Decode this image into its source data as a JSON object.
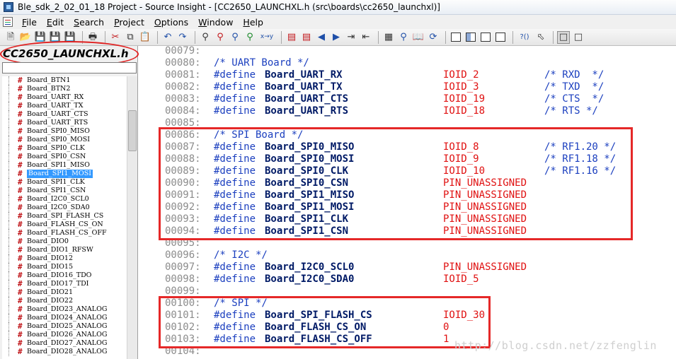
{
  "window": {
    "title": "Ble_sdk_2_02_01_18 Project - Source Insight - [CC2650_LAUNCHXL.h (src\\boards\\cc2650_launchxl)]"
  },
  "menu": [
    {
      "pre": "",
      "u": "F",
      "post": "ile"
    },
    {
      "pre": "",
      "u": "E",
      "post": "dit"
    },
    {
      "pre": "",
      "u": "S",
      "post": "earch"
    },
    {
      "pre": "",
      "u": "P",
      "post": "roject"
    },
    {
      "pre": "",
      "u": "O",
      "post": "ptions"
    },
    {
      "pre": "",
      "u": "W",
      "post": "indow"
    },
    {
      "pre": "",
      "u": "H",
      "post": "elp"
    }
  ],
  "toolbar": {
    "icons": [
      "new-file-icon",
      "open-folder-icon",
      "save-icon",
      "save-all-icon",
      "close-file-icon",
      "separator",
      "print-icon",
      "separator",
      "cut-icon",
      "copy-icon",
      "paste-icon",
      "separator",
      "undo-icon",
      "redo-icon",
      "separator",
      "search-icon",
      "search-files-icon",
      "search-project-icon",
      "lookup-references-icon",
      "replace-icon",
      "separator",
      "jump-bookmark-icon",
      "jump-list-icon",
      "back-icon",
      "forward-icon",
      "next-link-icon",
      "previous-link-icon",
      "separator",
      "symbol-window-icon",
      "relation-window-icon",
      "context-window-icon",
      "sync-icon",
      "separator",
      "project-window-icon",
      "layout-icon",
      "split-window-icon",
      "tile-icon",
      "separator",
      "help-icon",
      "cursor-icon",
      "separator",
      "toggle-view-icon",
      "toggle-panel-icon"
    ],
    "replace_label": "x→y",
    "help_label": "?()"
  },
  "sidebar": {
    "file_title": "CC2650_LAUNCHXL.h",
    "search_value": "",
    "symbols": [
      "Board_BTN1",
      "Board_BTN2",
      "Board_UART_RX",
      "Board_UART_TX",
      "Board_UART_CTS",
      "Board_UART_RTS",
      "Board_SPI0_MISO",
      "Board_SPI0_MOSI",
      "Board_SPI0_CLK",
      "Board_SPI0_CSN",
      "Board_SPI1_MISO",
      "Board_SPI1_MOSI",
      "Board_SPI1_CLK",
      "Board_SPI1_CSN",
      "Board_I2C0_SCL0",
      "Board_I2C0_SDA0",
      "Board_SPI_FLASH_CS",
      "Board_FLASH_CS_ON",
      "Board_FLASH_CS_OFF",
      "Board_DIO0",
      "Board_DIO1_RFSW",
      "Board_DIO12",
      "Board_DIO15",
      "Board_DIO16_TDO",
      "Board_DIO17_TDI",
      "Board_DIO21",
      "Board_DIO22",
      "Board_DIO23_ANALOG",
      "Board_DIO24_ANALOG",
      "Board_DIO25_ANALOG",
      "Board_DIO26_ANALOG",
      "Board_DIO27_ANALOG",
      "Board_DIO28_ANALOG"
    ],
    "selected_index": 11
  },
  "editor": {
    "lines": [
      {
        "n": "00079:",
        "kind": "blank"
      },
      {
        "n": "00080:",
        "kind": "comment",
        "text": "/* UART Board */"
      },
      {
        "n": "00081:",
        "kind": "define",
        "kw": "#define",
        "name": "Board_UART_RX",
        "value": "IOID_2",
        "comment": "/* RXD  */"
      },
      {
        "n": "00082:",
        "kind": "define",
        "kw": "#define",
        "name": "Board_UART_TX",
        "value": "IOID_3",
        "comment": "/* TXD  */"
      },
      {
        "n": "00083:",
        "kind": "define",
        "kw": "#define",
        "name": "Board_UART_CTS",
        "value": "IOID_19",
        "comment": "/* CTS  */"
      },
      {
        "n": "00084:",
        "kind": "define",
        "kw": "#define",
        "name": "Board_UART_RTS",
        "value": "IOID_18",
        "comment": "/* RTS */"
      },
      {
        "n": "00085:",
        "kind": "blank"
      },
      {
        "n": "00086:",
        "kind": "comment",
        "text": "/* SPI Board */"
      },
      {
        "n": "00087:",
        "kind": "define",
        "kw": "#define",
        "name": "Board_SPI0_MISO",
        "value": "IOID_8",
        "comment": "/* RF1.20 */"
      },
      {
        "n": "00088:",
        "kind": "define",
        "kw": "#define",
        "name": "Board_SPI0_MOSI",
        "value": "IOID_9",
        "comment": "/* RF1.18 */"
      },
      {
        "n": "00089:",
        "kind": "define",
        "kw": "#define",
        "name": "Board_SPI0_CLK",
        "value": "IOID_10",
        "comment": "/* RF1.16 */"
      },
      {
        "n": "00090:",
        "kind": "define",
        "kw": "#define",
        "name": "Board_SPI0_CSN",
        "value": "PIN_UNASSIGNED",
        "comment": ""
      },
      {
        "n": "00091:",
        "kind": "define",
        "kw": "#define",
        "name": "Board_SPI1_MISO",
        "value": "PIN_UNASSIGNED",
        "comment": ""
      },
      {
        "n": "00092:",
        "kind": "define",
        "kw": "#define",
        "name": "Board_SPI1_MOSI",
        "value": "PIN_UNASSIGNED",
        "comment": ""
      },
      {
        "n": "00093:",
        "kind": "define",
        "kw": "#define",
        "name": "Board_SPI1_CLK",
        "value": "PIN_UNASSIGNED",
        "comment": ""
      },
      {
        "n": "00094:",
        "kind": "define",
        "kw": "#define",
        "name": "Board_SPI1_CSN",
        "value": "PIN_UNASSIGNED",
        "comment": ""
      },
      {
        "n": "00095:",
        "kind": "blank"
      },
      {
        "n": "00096:",
        "kind": "comment",
        "text": "/* I2C */"
      },
      {
        "n": "00097:",
        "kind": "define",
        "kw": "#define",
        "name": "Board_I2C0_SCL0",
        "value": "PIN_UNASSIGNED",
        "comment": ""
      },
      {
        "n": "00098:",
        "kind": "define",
        "kw": "#define",
        "name": "Board_I2C0_SDA0",
        "value": "IOID_5",
        "comment": ""
      },
      {
        "n": "00099:",
        "kind": "blank"
      },
      {
        "n": "00100:",
        "kind": "comment",
        "text": "/* SPI */"
      },
      {
        "n": "00101:",
        "kind": "define",
        "kw": "#define",
        "name": "Board_SPI_FLASH_CS",
        "value": "IOID_30",
        "comment": ""
      },
      {
        "n": "00102:",
        "kind": "define",
        "kw": "#define",
        "name": "Board_FLASH_CS_ON",
        "value": "0",
        "comment": ""
      },
      {
        "n": "00103:",
        "kind": "define",
        "kw": "#define",
        "name": "Board_FLASH_CS_OFF",
        "value": "1",
        "comment": ""
      },
      {
        "n": "00104:",
        "kind": "blank"
      }
    ],
    "watermark": "http://blog.csdn.net/zzfenglin"
  },
  "colors": {
    "highlight_box": "#e52828",
    "keyword": "#1b3fbf",
    "macro_value": "#e01111",
    "selection": "#3399ff"
  }
}
